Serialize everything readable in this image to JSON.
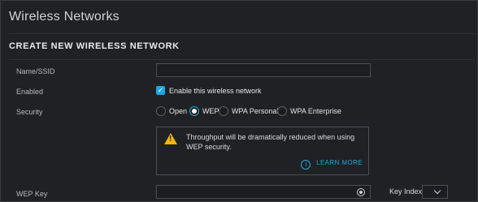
{
  "header": {
    "title": "Wireless Networks"
  },
  "section": {
    "title": "CREATE NEW WIRELESS NETWORK"
  },
  "form": {
    "name_label": "Name/SSID",
    "enabled_label": "Enabled",
    "enabled_text": "Enable this wireless network",
    "security_label": "Security",
    "security_options": [
      "Open",
      "WEP",
      "WPA Personal",
      "WPA Enterprise"
    ],
    "warning_text": "Throughput will be dramatically reduced when using WEP security.",
    "learn_more": "LEARN MORE",
    "wep_key_label": "WEP Key",
    "key_index_label": "Key Index"
  },
  "ui": {
    "accent_color": "#1ea7e1",
    "icons": [
      "warning-icon",
      "info-icon",
      "eye-icon",
      "chevron-down-icon"
    ]
  }
}
